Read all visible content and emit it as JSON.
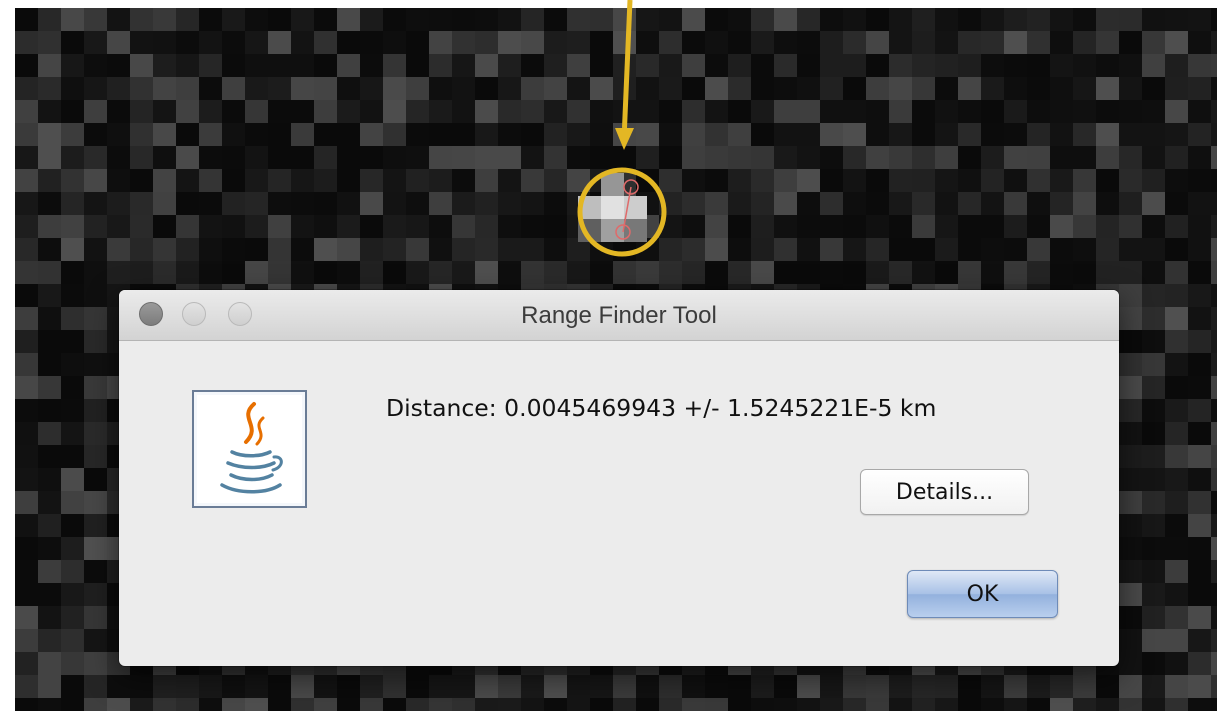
{
  "window": {
    "title": "Range Finder Tool",
    "controls": [
      "close",
      "minimize",
      "zoom"
    ]
  },
  "dialog": {
    "icon": "java-icon",
    "message": "Distance: 0.0045469943 +/- 1.5245221E-5 km"
  },
  "buttons": {
    "details_label": "Details...",
    "ok_label": "OK"
  },
  "colors": {
    "annotation": "#e3b724",
    "measure_line": "#e06a6a",
    "default_button": "#a8c1e6"
  }
}
